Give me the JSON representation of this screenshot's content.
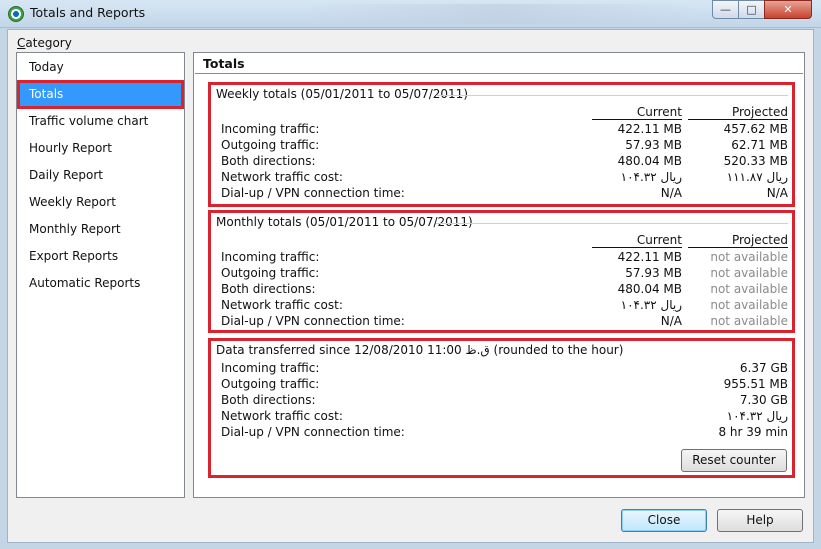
{
  "window": {
    "title": "Totals and Reports",
    "controls": {
      "minimize_icon": "minimize-icon",
      "maximize_icon": "maximize-icon",
      "close_icon": "close-icon"
    }
  },
  "category": {
    "label": "Category",
    "items": [
      {
        "label": "Today"
      },
      {
        "label": "Totals",
        "selected": true
      },
      {
        "label": "Traffic volume chart"
      },
      {
        "label": "Hourly Report"
      },
      {
        "label": "Daily Report"
      },
      {
        "label": "Weekly Report"
      },
      {
        "label": "Monthly Report"
      },
      {
        "label": "Export Reports"
      },
      {
        "label": "Automatic Reports"
      }
    ]
  },
  "main": {
    "title": "Totals",
    "weekly": {
      "heading": "Weekly totals (05/01/2011 to 05/07/2011)",
      "col_current": "Current",
      "col_projected": "Projected",
      "rows": [
        {
          "label": "Incoming traffic:",
          "current": "422.11 MB",
          "projected": "457.62 MB"
        },
        {
          "label": "Outgoing traffic:",
          "current": "57.93 MB",
          "projected": "62.71 MB"
        },
        {
          "label": "Both directions:",
          "current": "480.04 MB",
          "projected": "520.33 MB"
        },
        {
          "label": "Network traffic cost:",
          "current": "ريال ۱۰۴.۳۲",
          "projected": "ريال ۱۱۱.۸۷"
        },
        {
          "label": "Dial-up / VPN connection time:",
          "current": "N/A",
          "projected": "N/A"
        }
      ]
    },
    "monthly": {
      "heading": "Monthly totals (05/01/2011 to 05/07/2011)",
      "col_current": "Current",
      "col_projected": "Projected",
      "rows": [
        {
          "label": "Incoming traffic:",
          "current": "422.11 MB",
          "projected": "not available"
        },
        {
          "label": "Outgoing traffic:",
          "current": "57.93 MB",
          "projected": "not available"
        },
        {
          "label": "Both directions:",
          "current": "480.04 MB",
          "projected": "not available"
        },
        {
          "label": "Network traffic cost:",
          "current": "ريال ۱۰۴.۳۲",
          "projected": "not available"
        },
        {
          "label": "Dial-up / VPN connection time:",
          "current": "N/A",
          "projected": "not available"
        }
      ]
    },
    "since": {
      "heading": "Data transferred since 12/08/2010 11:00 ق.ظ (rounded to the hour)",
      "rows": [
        {
          "label": "Incoming traffic:",
          "value": "6.37 GB"
        },
        {
          "label": "Outgoing traffic:",
          "value": "955.51 MB"
        },
        {
          "label": "Both directions:",
          "value": "7.30 GB"
        },
        {
          "label": "Network traffic cost:",
          "value": "ريال ۱۰۴.۳۲"
        },
        {
          "label": "Dial-up / VPN connection time:",
          "value": "8 hr 39 min"
        }
      ],
      "reset_label": "Reset counter"
    }
  },
  "footer": {
    "close_label": "Close",
    "help_label": "Help"
  }
}
